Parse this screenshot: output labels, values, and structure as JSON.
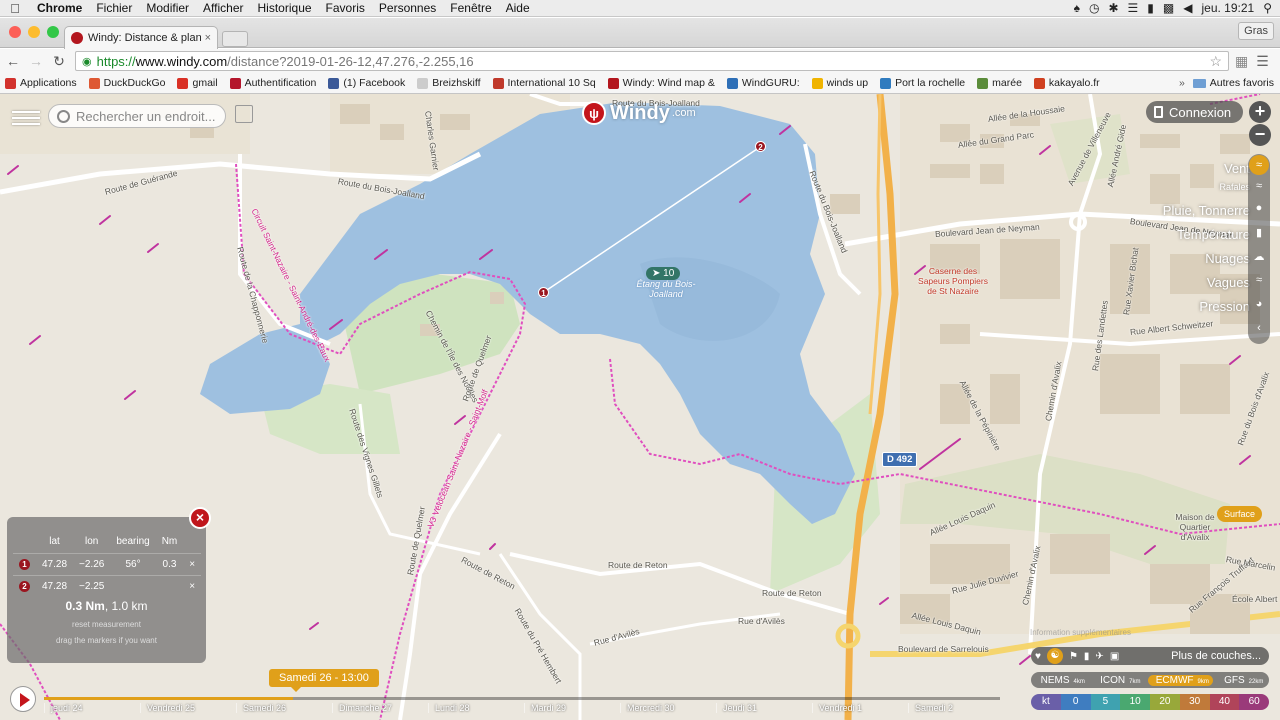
{
  "menubar": {
    "apple": "",
    "items": [
      "Chrome",
      "Fichier",
      "Modifier",
      "Afficher",
      "Historique",
      "Favoris",
      "Personnes",
      "Fenêtre",
      "Aide"
    ],
    "clock": "jeu. 19:21",
    "right_icons": [
      "hat-icon",
      "history-icon",
      "bluetooth-icon",
      "wifi-icon",
      "battery-icon",
      "display-icon",
      "volume-icon",
      "search-icon"
    ]
  },
  "tabbar": {
    "tab_title": "Windy: Distance & planific",
    "tab_close": "×",
    "profile": "Gras"
  },
  "toolbar": {
    "url_scheme": "https://",
    "url_host": "www.windy.com",
    "url_path": "/distance?2019-01-26-12,47.276,-2.255,16"
  },
  "bookmarks": {
    "items": [
      {
        "label": "Applications",
        "color": "#d2322d"
      },
      {
        "label": "DuckDuckGo",
        "color": "#de5833"
      },
      {
        "label": "gmail",
        "color": "#d93025"
      },
      {
        "label": "Authentification",
        "color": "#b4162c"
      },
      {
        "label": "(1) Facebook",
        "color": "#3b5998"
      },
      {
        "label": "Breizhskiff",
        "color": "#cccccc"
      },
      {
        "label": "International 10 Sq",
        "color": "#c0392b"
      },
      {
        "label": "Windy: Wind map &",
        "color": "#b3161e"
      },
      {
        "label": "WindGURU:",
        "color": "#2e6fb7"
      },
      {
        "label": "winds up",
        "color": "#f0b400"
      },
      {
        "label": "Port la rochelle",
        "color": "#2f7bbf"
      },
      {
        "label": "marée",
        "color": "#5b8c3a"
      },
      {
        "label": "kakayalo.fr",
        "color": "#d04020"
      }
    ],
    "more": "»",
    "folder": "Autres favoris"
  },
  "windy": {
    "search_placeholder": "Rechercher un endroit...",
    "logo_text": "Windy",
    "logo_suffix": ".com",
    "login": "Connexion",
    "zoom_in": "+",
    "zoom_out": "−",
    "layers": [
      "Vent",
      "Rafales",
      "Pluie, Tonnerre",
      "Température",
      "Nuages",
      "Vagues",
      "Pression"
    ],
    "layers_small": [
      1
    ],
    "surface": "Surface",
    "wind_marker": "10",
    "route_marker": "D 492",
    "map_labels": {
      "route_bois_joalland_top": "Route du Bois-Joalland",
      "route_bois_joalland_left": "Route du Bois-Joalland",
      "route_bois_joalland_right": "Route du Bois-Joalland",
      "route_guerande": "Route de Guérande",
      "charles_garnier": "Charles Garnier",
      "chapponerie": "Route de la Chapponnerie",
      "greenway": "Circuit Saint-Nazaire - Saint-André-des-Eaux",
      "chemin_noelles": "Chemin de l'Île des Noëlles",
      "vignes": "Route des Vignes Gillets",
      "quelmer": "Route de Quelmer",
      "quelmer2": "Route de Quelmer",
      "velocean": "V3 Vélocéan Saint-Nazaire - Saint-Molf",
      "reton": "Route de Reton",
      "reton2": "Route de Reton",
      "reton3": "Route de Reton",
      "pre_hembert": "Route du Pré Hembert",
      "aviles": "Rue d'Avilès",
      "aviles2": "Rue d'Avilès",
      "lake_name": "Étang du Bois-Joalland",
      "jean_neyman": "Boulevard Jean de Neyman",
      "jean_neyman2": "Boulevard Jean de Neyman",
      "pompiers": "Caserne des Sapeurs Pompiers de St Nazaire",
      "houssaie": "Allée de la Houssaie",
      "grand_parc": "Allée du Grand Parc",
      "villeneuve": "Avenue de Villeneuve",
      "andre_gide": "Allée André Gide",
      "chemin_avalix": "Chemin d'Avalix",
      "chemin_avalix2": "Chemin d'Avalix",
      "landelles": "Rue des Landettes",
      "xavier_bichat": "Rue Xavier Bichat",
      "albert_schweitzer": "Rue Albert Schweitzer",
      "pepiniere": "Allée de la Pépinière",
      "louis_daquin": "Allée Louis Daquin",
      "louis_daquin2": "Allée Louis Daquin",
      "julie_duvivier": "Rue Julie Duvivier",
      "sarrelouis": "Boulevard de Sarrelouis",
      "maison_avalix": "Maison de Quartier d'Avalix",
      "francois_truffaut": "Rue François Truffaut",
      "marcellin": "Rue Marcelin",
      "ecole": "École Albert",
      "bois_avalix": "Rue du Bois d'Avalix"
    }
  },
  "distance": {
    "headers": [
      "lat",
      "lon",
      "bearing",
      "Nm"
    ],
    "rows": [
      {
        "n": "1",
        "lat": "47.28",
        "lon": "−2.26",
        "bearing": "56°",
        "nm": "0.3",
        "x": "×"
      },
      {
        "n": "2",
        "lat": "47.28",
        "lon": "−2.25",
        "bearing": "",
        "nm": "",
        "x": "×"
      }
    ],
    "summary_nm": "0.3 Nm",
    "summary_km": "1.0 km",
    "reset": "reset measurement",
    "hint": "drag the markers if you want",
    "close": "×"
  },
  "timeline": {
    "current": "Samedi 26 - 13:00",
    "progress_fraction": 0.26,
    "days": [
      "jeudi 24",
      "Vendredi 25",
      "Samedi 26",
      "Dimanche 27",
      "Lundi 28",
      "Mardi 29",
      "Mercredi 30",
      "Jeudi 31",
      "Vendredi 1",
      "Samedi 2"
    ]
  },
  "tools": {
    "more_layers": "Plus de couches...",
    "models": [
      {
        "name": "NEMS",
        "res": "4km",
        "on": false
      },
      {
        "name": "ICON",
        "res": "7km",
        "on": false
      },
      {
        "name": "ECMWF",
        "res": "9km",
        "on": true
      },
      {
        "name": "GFS",
        "res": "22km",
        "on": false
      }
    ],
    "scale_unit": "kt",
    "scale_values": [
      "0",
      "5",
      "10",
      "20",
      "30",
      "40",
      "60"
    ],
    "scale_colors": [
      "#6a5fa8",
      "#3f7dc0",
      "#3fa2b0",
      "#4aa870",
      "#98a83a",
      "#c07a3a",
      "#b0445a",
      "#9a3a7a"
    ],
    "attribution": "Information supplémentaires"
  },
  "colors": {
    "accent": "#e0a01a",
    "windy_red": "#c4151c",
    "water": "#9ec0e0",
    "marker": "#9a1620"
  }
}
